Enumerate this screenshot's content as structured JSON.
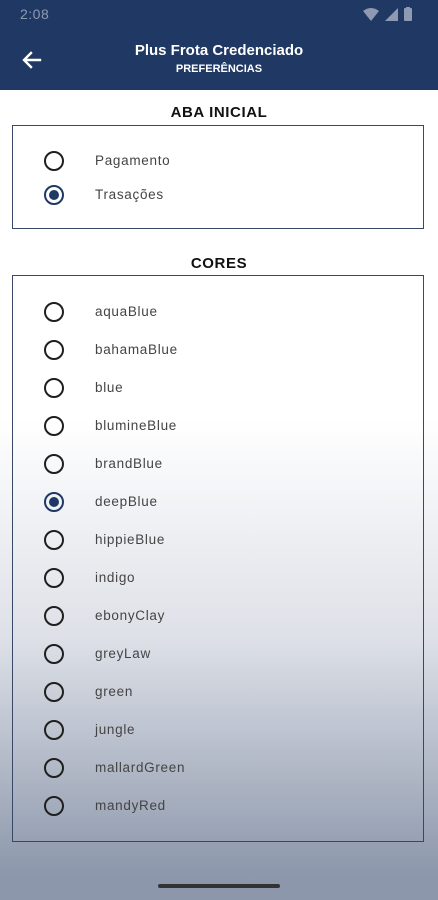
{
  "status_bar": {
    "time": "2:08"
  },
  "app_bar": {
    "title": "Plus Frota Credenciado",
    "subtitle": "PREFERÊNCIAS",
    "back_icon": "arrow-left-icon"
  },
  "aba_inicial": {
    "title": "ABA INICIAL",
    "options": [
      {
        "label": "Pagamento",
        "checked": false
      },
      {
        "label": "Trasações",
        "checked": true
      }
    ]
  },
  "cores": {
    "title": "CORES",
    "options": [
      {
        "label": "aquaBlue",
        "checked": false
      },
      {
        "label": "bahamaBlue",
        "checked": false
      },
      {
        "label": "blue",
        "checked": false
      },
      {
        "label": "blumineBlue",
        "checked": false
      },
      {
        "label": "brandBlue",
        "checked": false
      },
      {
        "label": "deepBlue",
        "checked": true
      },
      {
        "label": "hippieBlue",
        "checked": false
      },
      {
        "label": "indigo",
        "checked": false
      },
      {
        "label": "ebonyClay",
        "checked": false
      },
      {
        "label": "greyLaw",
        "checked": false
      },
      {
        "label": "green",
        "checked": false
      },
      {
        "label": "jungle",
        "checked": false
      },
      {
        "label": "mallardGreen",
        "checked": false
      },
      {
        "label": "mandyRed",
        "checked": false
      }
    ]
  },
  "colors": {
    "primary": "#203864",
    "border": "#3a4868"
  }
}
